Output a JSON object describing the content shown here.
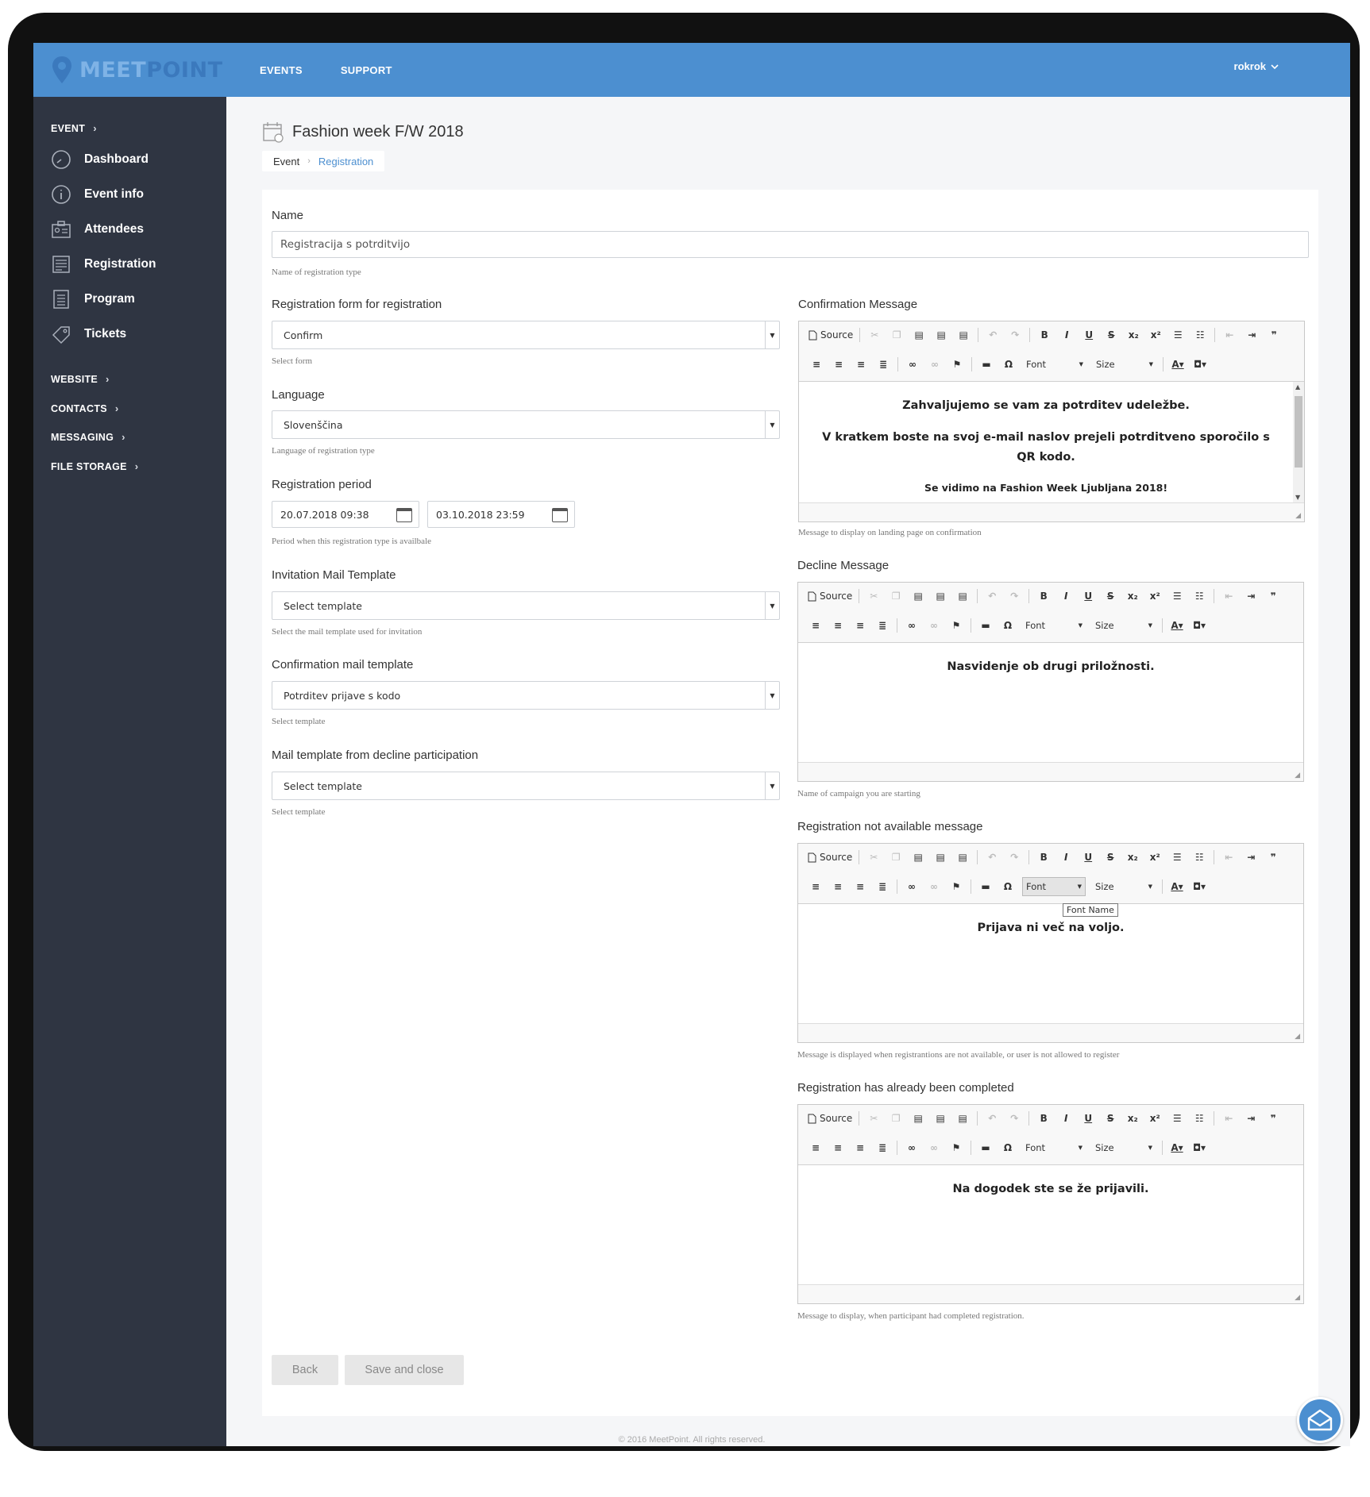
{
  "app": {
    "logo_light": "MEET",
    "logo_bold": "POINT",
    "brand_color": "#4c8fd0",
    "sidebar_color": "#2f3542"
  },
  "topnav": {
    "events": "EVENTS",
    "support": "SUPPORT",
    "user": "rokrok"
  },
  "sidebar": {
    "event": "EVENT",
    "items": [
      {
        "label": "Dashboard",
        "icon": "gauge-icon"
      },
      {
        "label": "Event info",
        "icon": "info-icon"
      },
      {
        "label": "Attendees",
        "icon": "badge-icon"
      },
      {
        "label": "Registration",
        "icon": "form-icon"
      },
      {
        "label": "Program",
        "icon": "list-icon"
      },
      {
        "label": "Tickets",
        "icon": "ticket-icon"
      }
    ],
    "sections": [
      "WEBSITE",
      "CONTACTS",
      "MESSAGING",
      "FILE STORAGE"
    ]
  },
  "page": {
    "title": "Fashion week F/W 2018",
    "breadcrumb": [
      "Event",
      "Registration"
    ]
  },
  "form": {
    "name_label": "Name",
    "name_value": "Registracija s potrditvijo",
    "name_hint": "Name of registration type",
    "regform_label": "Registration form for registration",
    "regform_value": "Confirm",
    "regform_hint": "Select form",
    "language_label": "Language",
    "language_value": "Slovenščina",
    "language_hint": "Language of registration type",
    "period_label": "Registration period",
    "period_start": "20.07.2018 09:38",
    "period_end": "03.10.2018 23:59",
    "period_hint": "Period when this registration type is availbale",
    "invite_label": "Invitation Mail Template",
    "invite_value": "Select template",
    "invite_hint": "Select the mail template used for invitation",
    "confirm_tpl_label": "Confirmation mail template",
    "confirm_tpl_value": "Potrditev prijave s kodo",
    "confirm_tpl_hint": "Select template",
    "decline_tpl_label": "Mail template from decline participation",
    "decline_tpl_value": "Select template",
    "decline_tpl_hint": "Select template"
  },
  "toolbar": {
    "source": "Source",
    "bold": "B",
    "italic": "I",
    "underline": "U",
    "strike": "S",
    "subscript": "x₂",
    "superscript": "x²",
    "omega": "Ω",
    "font": "Font",
    "size": "Size",
    "font_tooltip": "Font Name"
  },
  "editors": {
    "confirmation": {
      "label": "Confirmation Message",
      "line1": "Zahvaljujemo se vam za potrditev udeležbe.",
      "line2": "V kratkem boste na svoj e-mail naslov prejeli potrditveno sporočilo s QR kodo.",
      "line3": "Se vidimo na Fashion Week Ljubljana 2018!",
      "hint": "Message to display on landing page on confirmation"
    },
    "decline": {
      "label": "Decline Message",
      "text": "Nasvidenje ob drugi priložnosti.",
      "hint": "Name of campaign you are starting"
    },
    "not_available": {
      "label": "Registration not available message",
      "text": "Prijava ni več na voljo.",
      "hint": "Message is displayed when registrantions are not available, or user is not allowed to register"
    },
    "completed": {
      "label": "Registration has already been completed",
      "text": "Na dogodek ste se že prijavili.",
      "hint": "Message to display, when participant had completed registration."
    }
  },
  "buttons": {
    "back": "Back",
    "save": "Save and close"
  },
  "footer": "© 2016 MeetPoint. All rights reserved."
}
